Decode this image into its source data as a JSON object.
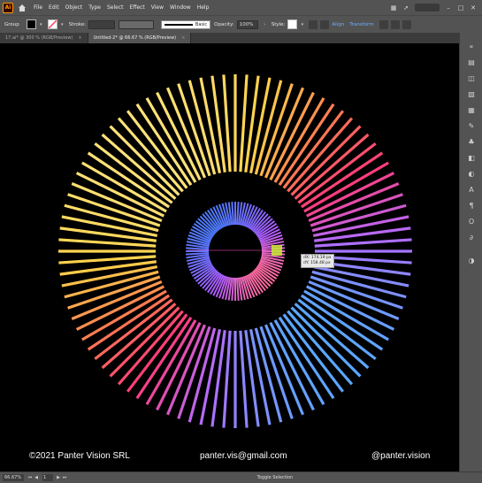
{
  "menubar": {
    "logo": "Ai",
    "items": [
      "File",
      "Edit",
      "Object",
      "Type",
      "Select",
      "Effect",
      "View",
      "Window",
      "Help"
    ]
  },
  "controlbar": {
    "selection_label": "Group",
    "stroke_label": "Stroke:",
    "brush_label": "Basic",
    "opacity_label": "Opacity:",
    "opacity_value": "100%",
    "style_label": "Style:",
    "align_label": "Align",
    "transform_label": "Transform",
    "fill_color": "#000000",
    "stroke_color": "#ff3d5a"
  },
  "tabs": [
    {
      "label": "17.ai* @ 300 % (RGB/Preview)",
      "active": false
    },
    {
      "label": "Untitled-2* @ 66.67 % (RGB/Preview)",
      "active": true
    }
  ],
  "canvas": {
    "tooltip_line1": "dX: 174.19 px",
    "tooltip_line2": "dY: 158.48 px"
  },
  "watermark": {
    "copyright": "©2021 Panter Vision SRL",
    "email": "panter.vis@gmail.com",
    "handle": "@panter.vision"
  },
  "statusbar": {
    "zoom": "66.67%",
    "page": "1",
    "status": "Toggle Selection"
  },
  "colors": {
    "gradient_outer": [
      "#ff2e63",
      "#ff9a3c",
      "#ffd84a"
    ],
    "gradient_inner": [
      "#4d6bff",
      "#9b5cff"
    ]
  }
}
